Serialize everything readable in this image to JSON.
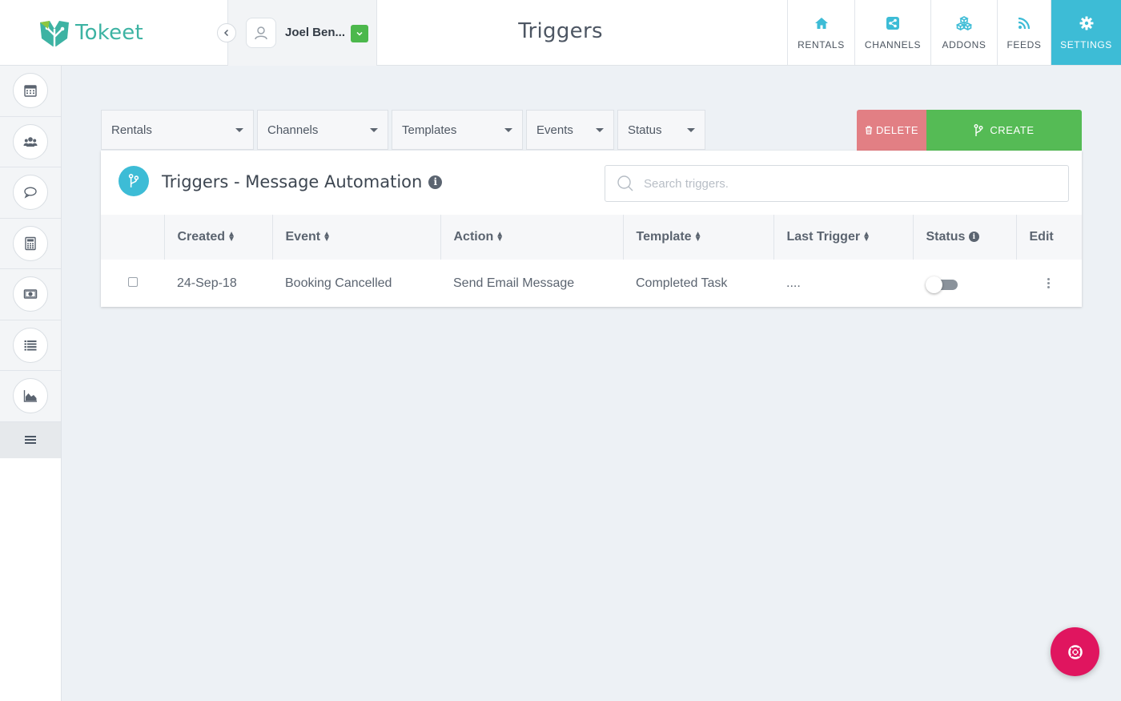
{
  "app": {
    "name": "Tokeet"
  },
  "header": {
    "title": "Triggers",
    "user": {
      "name": "Joel Ben..."
    },
    "nav": [
      {
        "label": "RENTALS",
        "icon": "home-icon"
      },
      {
        "label": "CHANNELS",
        "icon": "share-icon"
      },
      {
        "label": "ADDONS",
        "icon": "cubes-icon"
      },
      {
        "label": "FEEDS",
        "icon": "rss-icon"
      },
      {
        "label": "SETTINGS",
        "icon": "gear-icon",
        "active": true
      }
    ]
  },
  "sidebar": {
    "items": [
      {
        "icon": "calendar-icon"
      },
      {
        "icon": "users-icon"
      },
      {
        "icon": "chat-icon"
      },
      {
        "icon": "calculator-icon"
      },
      {
        "icon": "money-icon"
      },
      {
        "icon": "list-icon"
      },
      {
        "icon": "area-chart-icon"
      }
    ],
    "menu_icon": "hamburger-icon"
  },
  "filters": [
    {
      "label": "Rentals"
    },
    {
      "label": "Channels"
    },
    {
      "label": "Templates"
    },
    {
      "label": "Events"
    },
    {
      "label": "Status"
    }
  ],
  "actions": {
    "delete_label": "DELETE",
    "create_label": "CREATE"
  },
  "panel": {
    "title": "Triggers - Message Automation",
    "search_placeholder": "Search triggers.",
    "columns": [
      "Created",
      "Event",
      "Action",
      "Template",
      "Last Trigger",
      "Status",
      "Edit"
    ],
    "rows": [
      {
        "created": "24-Sep-18",
        "event": "Booking Cancelled",
        "action": "Send Email Message",
        "template": "Completed Task",
        "last_trigger": "....",
        "status_on": false
      }
    ]
  },
  "colors": {
    "accent": "#3dbcd6",
    "create": "#55bb55",
    "delete": "#e27f84",
    "help": "#e0155f",
    "brand": "#3db3a3"
  }
}
